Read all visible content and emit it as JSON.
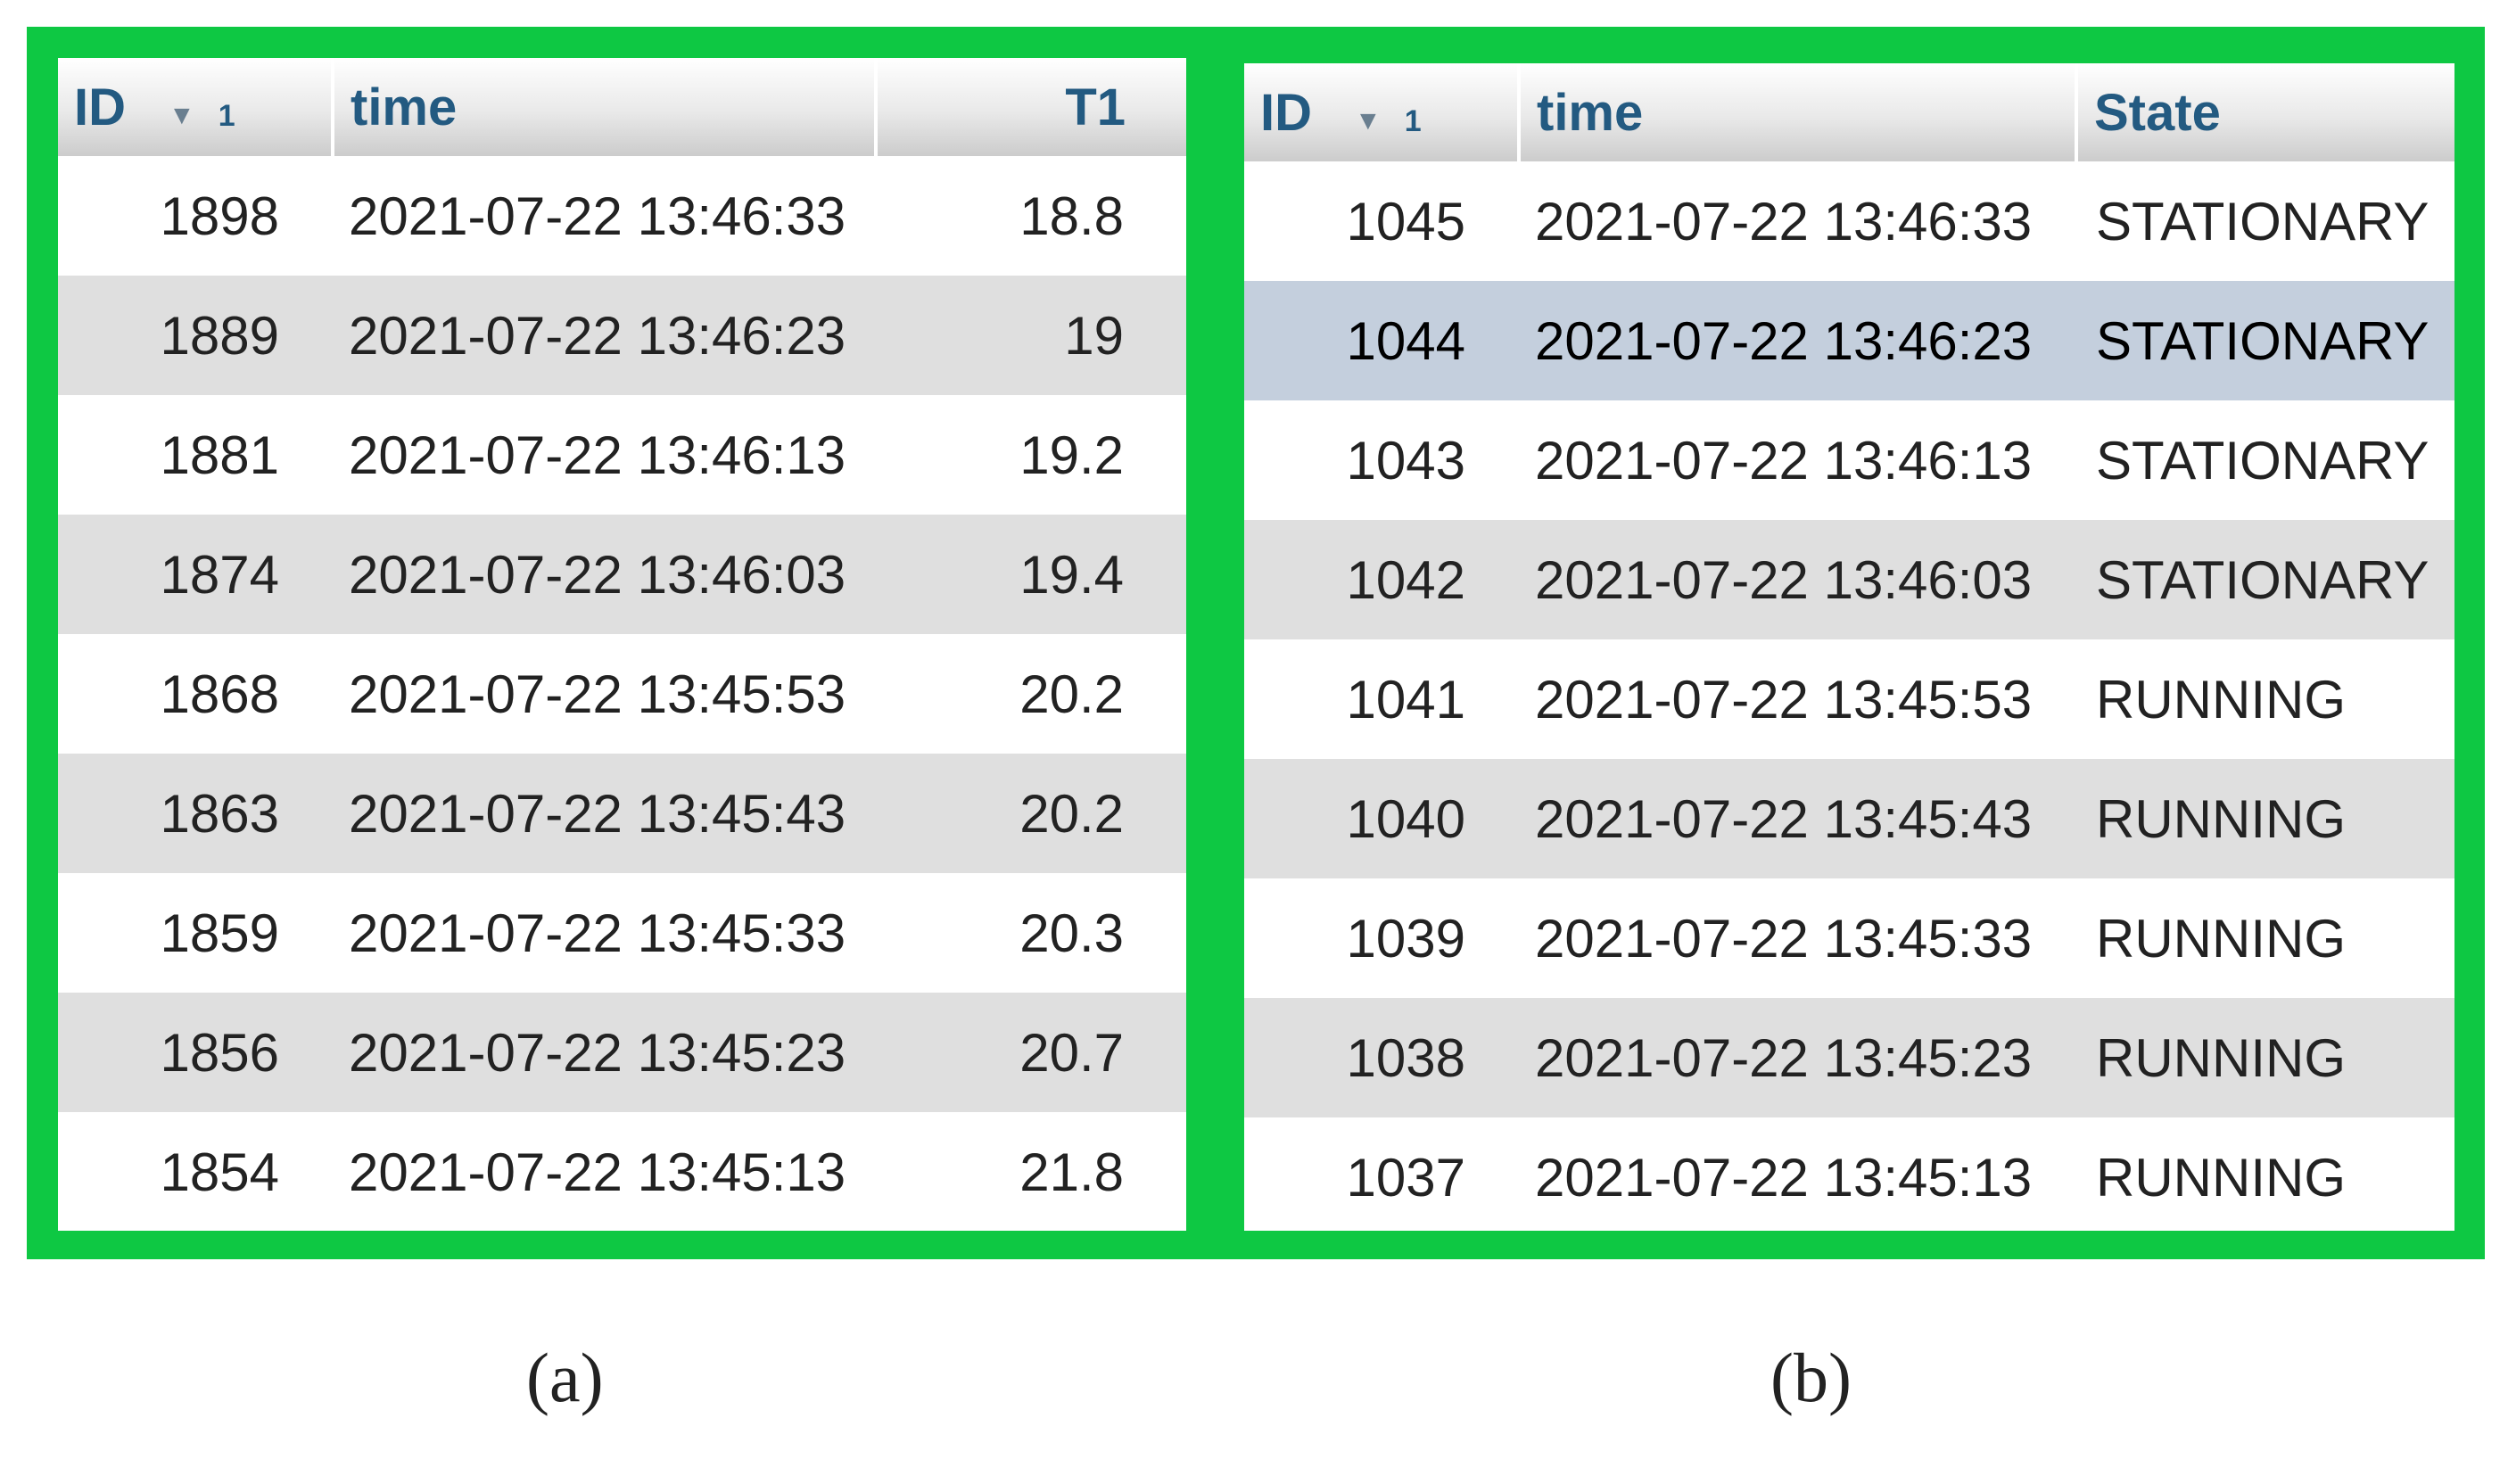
{
  "panel_a": {
    "columns": {
      "id": "ID",
      "sort_order": "1",
      "time": "time",
      "value": "T1"
    },
    "rows": [
      {
        "id": "1898",
        "time": "2021-07-22 13:46:33",
        "value": "18.8"
      },
      {
        "id": "1889",
        "time": "2021-07-22 13:46:23",
        "value": "19"
      },
      {
        "id": "1881",
        "time": "2021-07-22 13:46:13",
        "value": "19.2"
      },
      {
        "id": "1874",
        "time": "2021-07-22 13:46:03",
        "value": "19.4"
      },
      {
        "id": "1868",
        "time": "2021-07-22 13:45:53",
        "value": "20.2"
      },
      {
        "id": "1863",
        "time": "2021-07-22 13:45:43",
        "value": "20.2"
      },
      {
        "id": "1859",
        "time": "2021-07-22 13:45:33",
        "value": "20.3"
      },
      {
        "id": "1856",
        "time": "2021-07-22 13:45:23",
        "value": "20.7"
      },
      {
        "id": "1854",
        "time": "2021-07-22 13:45:13",
        "value": "21.8"
      }
    ]
  },
  "panel_b": {
    "columns": {
      "id": "ID",
      "sort_order": "1",
      "time": "time",
      "state": "State"
    },
    "rows": [
      {
        "id": "1045",
        "time": "2021-07-22 13:46:33",
        "state": "STATIONARY"
      },
      {
        "id": "1044",
        "time": "2021-07-22 13:46:23",
        "state": "STATIONARY"
      },
      {
        "id": "1043",
        "time": "2021-07-22 13:46:13",
        "state": "STATIONARY"
      },
      {
        "id": "1042",
        "time": "2021-07-22 13:46:03",
        "state": "STATIONARY"
      },
      {
        "id": "1041",
        "time": "2021-07-22 13:45:53",
        "state": "RUNNING"
      },
      {
        "id": "1040",
        "time": "2021-07-22 13:45:43",
        "state": "RUNNING"
      },
      {
        "id": "1039",
        "time": "2021-07-22 13:45:33",
        "state": "RUNNING"
      },
      {
        "id": "1038",
        "time": "2021-07-22 13:45:23",
        "state": "RUNNING"
      },
      {
        "id": "1037",
        "time": "2021-07-22 13:45:13",
        "state": "RUNNING"
      }
    ],
    "selected_row_index": 1
  },
  "captions": {
    "a": "(a)",
    "b": "(b)"
  },
  "colors": {
    "frame": "#0ec843",
    "header_text": "#235a81",
    "row_stripe": "#dfdfdf",
    "row_selected": "#c4cfdd"
  },
  "icons": {
    "sort": "sort-descending-icon"
  }
}
